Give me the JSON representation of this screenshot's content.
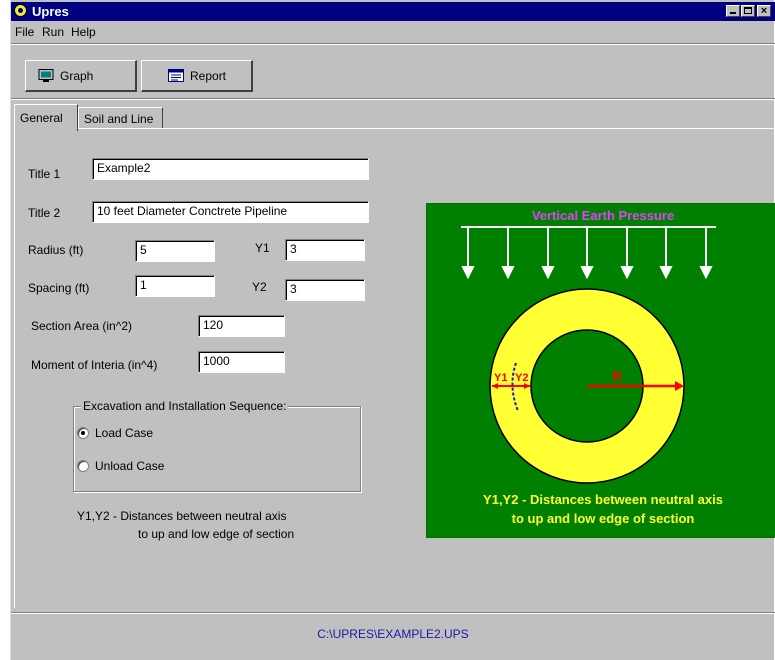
{
  "window": {
    "title": "Upres"
  },
  "menu": [
    "File",
    "Run",
    "Help"
  ],
  "toolbar": {
    "graph_label": "Graph",
    "report_label": "Report"
  },
  "tabs": [
    {
      "label": "General",
      "active": true
    },
    {
      "label": "Soil and Line",
      "active": false
    }
  ],
  "form": {
    "title1": {
      "label": "Title 1",
      "value": "Example2"
    },
    "title2": {
      "label": "Title 2",
      "value": "10 feet Diameter Conctrete Pipeline"
    },
    "radius": {
      "label": "Radius (ft)",
      "value": "5"
    },
    "y1": {
      "label": "Y1",
      "value": "3"
    },
    "spacing": {
      "label": "Spacing (ft)",
      "value": "1"
    },
    "y2": {
      "label": "Y2",
      "value": "3"
    },
    "section_area": {
      "label": "Section Area (in^2)",
      "value": "120"
    },
    "moment": {
      "label": "Moment of Interia (in^4)",
      "value": "1000"
    }
  },
  "sequence": {
    "title": "Excavation and Installation Sequence:",
    "options": [
      {
        "label": "Load Case",
        "selected": true
      },
      {
        "label": "Unload Case",
        "selected": false
      }
    ]
  },
  "note": {
    "line1": "Y1,Y2 - Distances between neutral axis",
    "line2": "to up and low edge of section"
  },
  "diagram": {
    "title": "Vertical Earth Pressure",
    "y1_label": "Y1",
    "y2_label": "Y2",
    "r_label": "R",
    "caption_line1": "Y1,Y2 - Distances between neutral axis",
    "caption_line2": "to up and low edge of section",
    "colors": {
      "background": "#008000",
      "ring": "#ffff33",
      "title": "#e040fb",
      "radius": "#ff0000",
      "axis": "#1a1acc",
      "caption": "#ffff33",
      "arrows": "#ffffff"
    }
  },
  "status": {
    "path": "C:\\UPRES\\EXAMPLE2.UPS"
  }
}
